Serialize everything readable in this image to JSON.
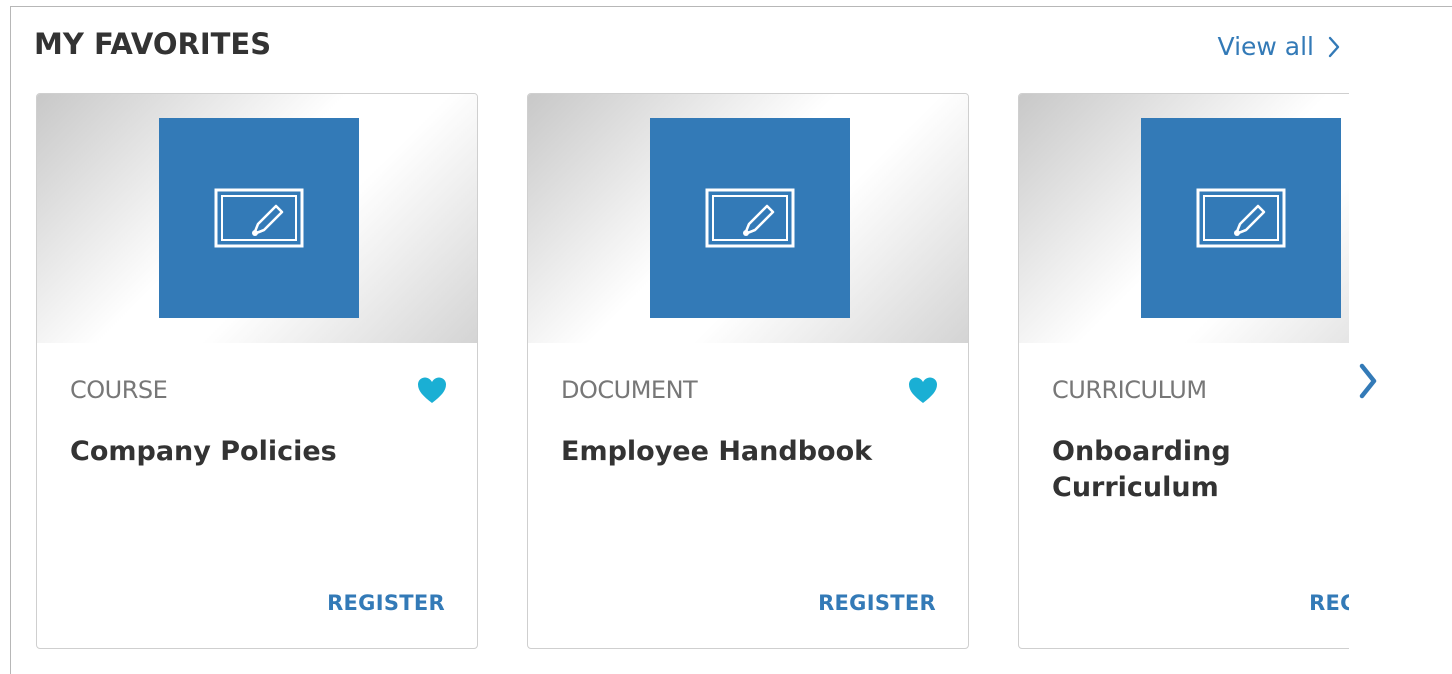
{
  "section": {
    "title": "MY FAVORITES",
    "view_all_label": "View all"
  },
  "colors": {
    "accent": "#337ab7",
    "favorite": "#1aafd4",
    "title_text": "#333333",
    "type_text": "#777777"
  },
  "cards": [
    {
      "type": "COURSE",
      "title": "Company Policies",
      "action": "REGISTER",
      "favorited": true,
      "icon": "edit-form-icon"
    },
    {
      "type": "DOCUMENT",
      "title": "Employee Handbook",
      "action": "REGISTER",
      "favorited": true,
      "icon": "edit-form-icon"
    },
    {
      "type": "CURRICULUM",
      "title": "Onboarding Curriculum",
      "action": "REGISTER",
      "favorited": false,
      "icon": "edit-form-icon"
    }
  ],
  "carousel": {
    "next_icon": "chevron-right-icon"
  }
}
